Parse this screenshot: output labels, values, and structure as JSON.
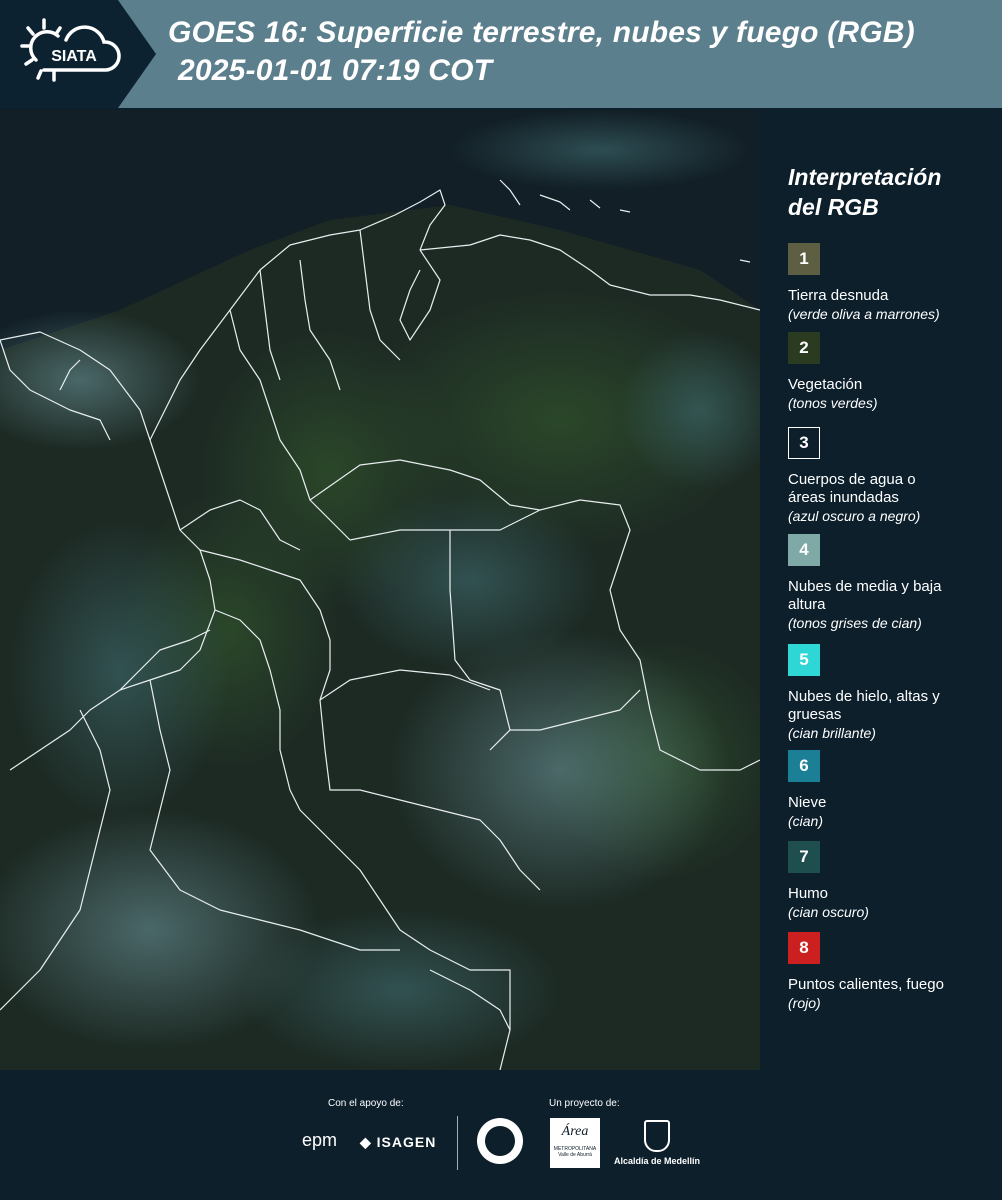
{
  "header": {
    "logo_text": "SIATA",
    "title_line1": "GOES 16: Superficie terrestre, nubes y fuego (RGB)",
    "title_line2": "2025-01-01 07:19 COT"
  },
  "map": {
    "image": "satellite-rgb-composite-colombia",
    "background_color": "#0f1d24"
  },
  "legend": {
    "title_line1": "Interpretación",
    "title_line2": "del RGB",
    "items": [
      {
        "number": "1",
        "color": "#5e5e42",
        "label": "Tierra desnuda",
        "note": "(verde oliva a marrones)"
      },
      {
        "number": "2",
        "color": "#2b3b20",
        "label": "Vegetación",
        "note": "(tonos verdes)"
      },
      {
        "number": "3",
        "color": "#0c1f2b",
        "label": "Cuerpos de agua o áreas inundadas",
        "note": "(azul oscuro a negro)"
      },
      {
        "number": "4",
        "color": "#7fa9a6",
        "label": "Nubes de media y baja altura",
        "note": "(tonos grises de cian)"
      },
      {
        "number": "5",
        "color": "#2fd6d6",
        "label": "Nubes de hielo, altas y gruesas",
        "note": "(cian brillante)"
      },
      {
        "number": "6",
        "color": "#1b8096",
        "label": "Nieve",
        "note": "(cian)"
      },
      {
        "number": "7",
        "color": "#1f4e4e",
        "label": "Humo",
        "note": "(cian oscuro)"
      },
      {
        "number": "8",
        "color": "#cc1f1f",
        "label": "Puntos calientes, fuego",
        "note": "(rojo)"
      }
    ]
  },
  "footer": {
    "support_label": "Con el apoyo de:",
    "project_label": "Un proyecto de:",
    "logos": {
      "epm": "epm",
      "isagen": "ISAGEN",
      "area_metropolitana_title": "Área",
      "area_metropolitana_sub": "METROPOLITANA",
      "area_metropolitana_sub2": "Valle de Aburrá",
      "alcaldia": "Alcaldía de Medellín"
    }
  }
}
